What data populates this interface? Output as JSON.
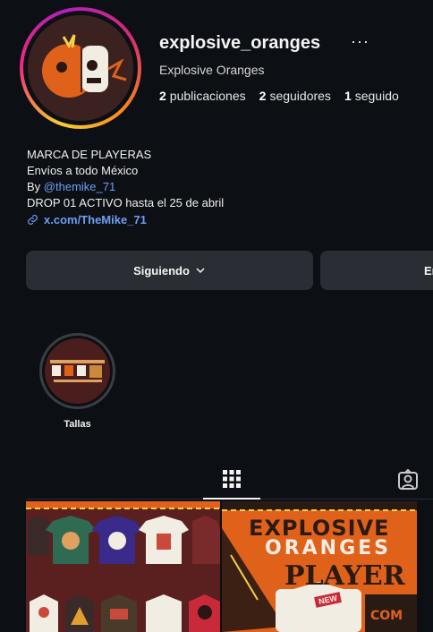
{
  "profile": {
    "username": "explosive_oranges",
    "more_label": "···",
    "full_name": "Explosive Oranges",
    "stats": {
      "posts_count": "2",
      "posts_label": "publicaciones",
      "followers_count": "2",
      "followers_label": "seguidores",
      "following_count": "1",
      "following_label": "seguido"
    }
  },
  "bio": {
    "line1": "MARCA DE PLAYERAS",
    "line2": "Envíos a todo México",
    "by_prefix": "By ",
    "mention": "@themike_71",
    "line4": "DROP 01 ACTIVO hasta el 25 de abril",
    "link": "x.com/TheMike_71"
  },
  "actions": {
    "follow_label": "Siguiendo",
    "message_label_visible": "En"
  },
  "highlights": [
    {
      "label": "Tallas"
    }
  ],
  "posts": {
    "post2_text_line1": "EXPLOSIVE",
    "post2_text_line2": "ORANGES",
    "post2_text_line3": "PLAYER",
    "post2_badge": "NEW",
    "post2_bottom": "COM"
  },
  "colors": {
    "background": "#0c0f14",
    "button_bg": "#2a2e34",
    "link": "#6f9ff5",
    "brand_orange": "#e0621a"
  }
}
